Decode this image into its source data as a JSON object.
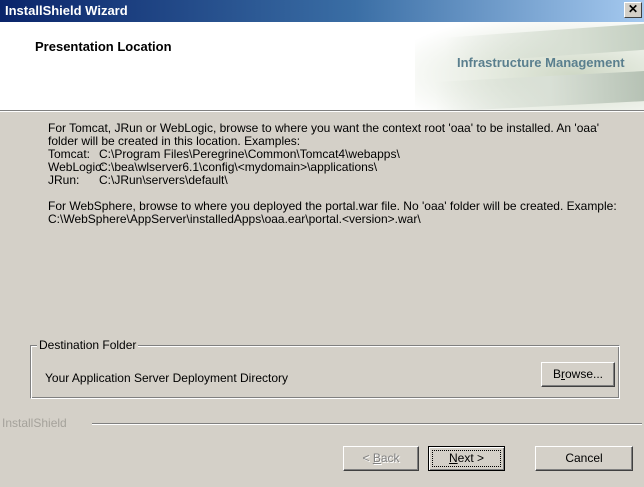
{
  "window": {
    "title": "InstallShield Wizard",
    "close_glyph": "✕"
  },
  "header": {
    "heading": "Presentation Location",
    "brand": "Infrastructure Management"
  },
  "body": {
    "intro": "For Tomcat, JRun or WebLogic,  browse to where you want the context root 'oaa' to be installed. An 'oaa' folder will be created in this location. Examples:",
    "examples": [
      {
        "label": "Tomcat:",
        "path": "C:\\Program Files\\Peregrine\\Common\\Tomcat4\\webapps\\"
      },
      {
        "label": "WebLogic:",
        "path": "C:\\bea\\wlserver6.1\\config\\<mydomain>\\applications\\"
      },
      {
        "label": "JRun:",
        "path": "C:\\JRun\\servers\\default\\"
      }
    ],
    "websphere": "For WebSphere, browse to where you deployed the portal.war file. No 'oaa' folder will be created. Example:",
    "websphere_path": "C:\\WebSphere\\AppServer\\installedApps\\oaa.ear\\portal.<version>.war\\"
  },
  "destination": {
    "legend": "Destination Folder",
    "label": "Your Application Server Deployment Directory",
    "browse_pre": "B",
    "browse_u": "r",
    "browse_post": "owse..."
  },
  "footer": {
    "brand_label": "InstallShield",
    "back_pre": "< ",
    "back_u": "B",
    "back_post": "ack",
    "next_u": "N",
    "next_post": "ext >",
    "cancel": "Cancel"
  }
}
